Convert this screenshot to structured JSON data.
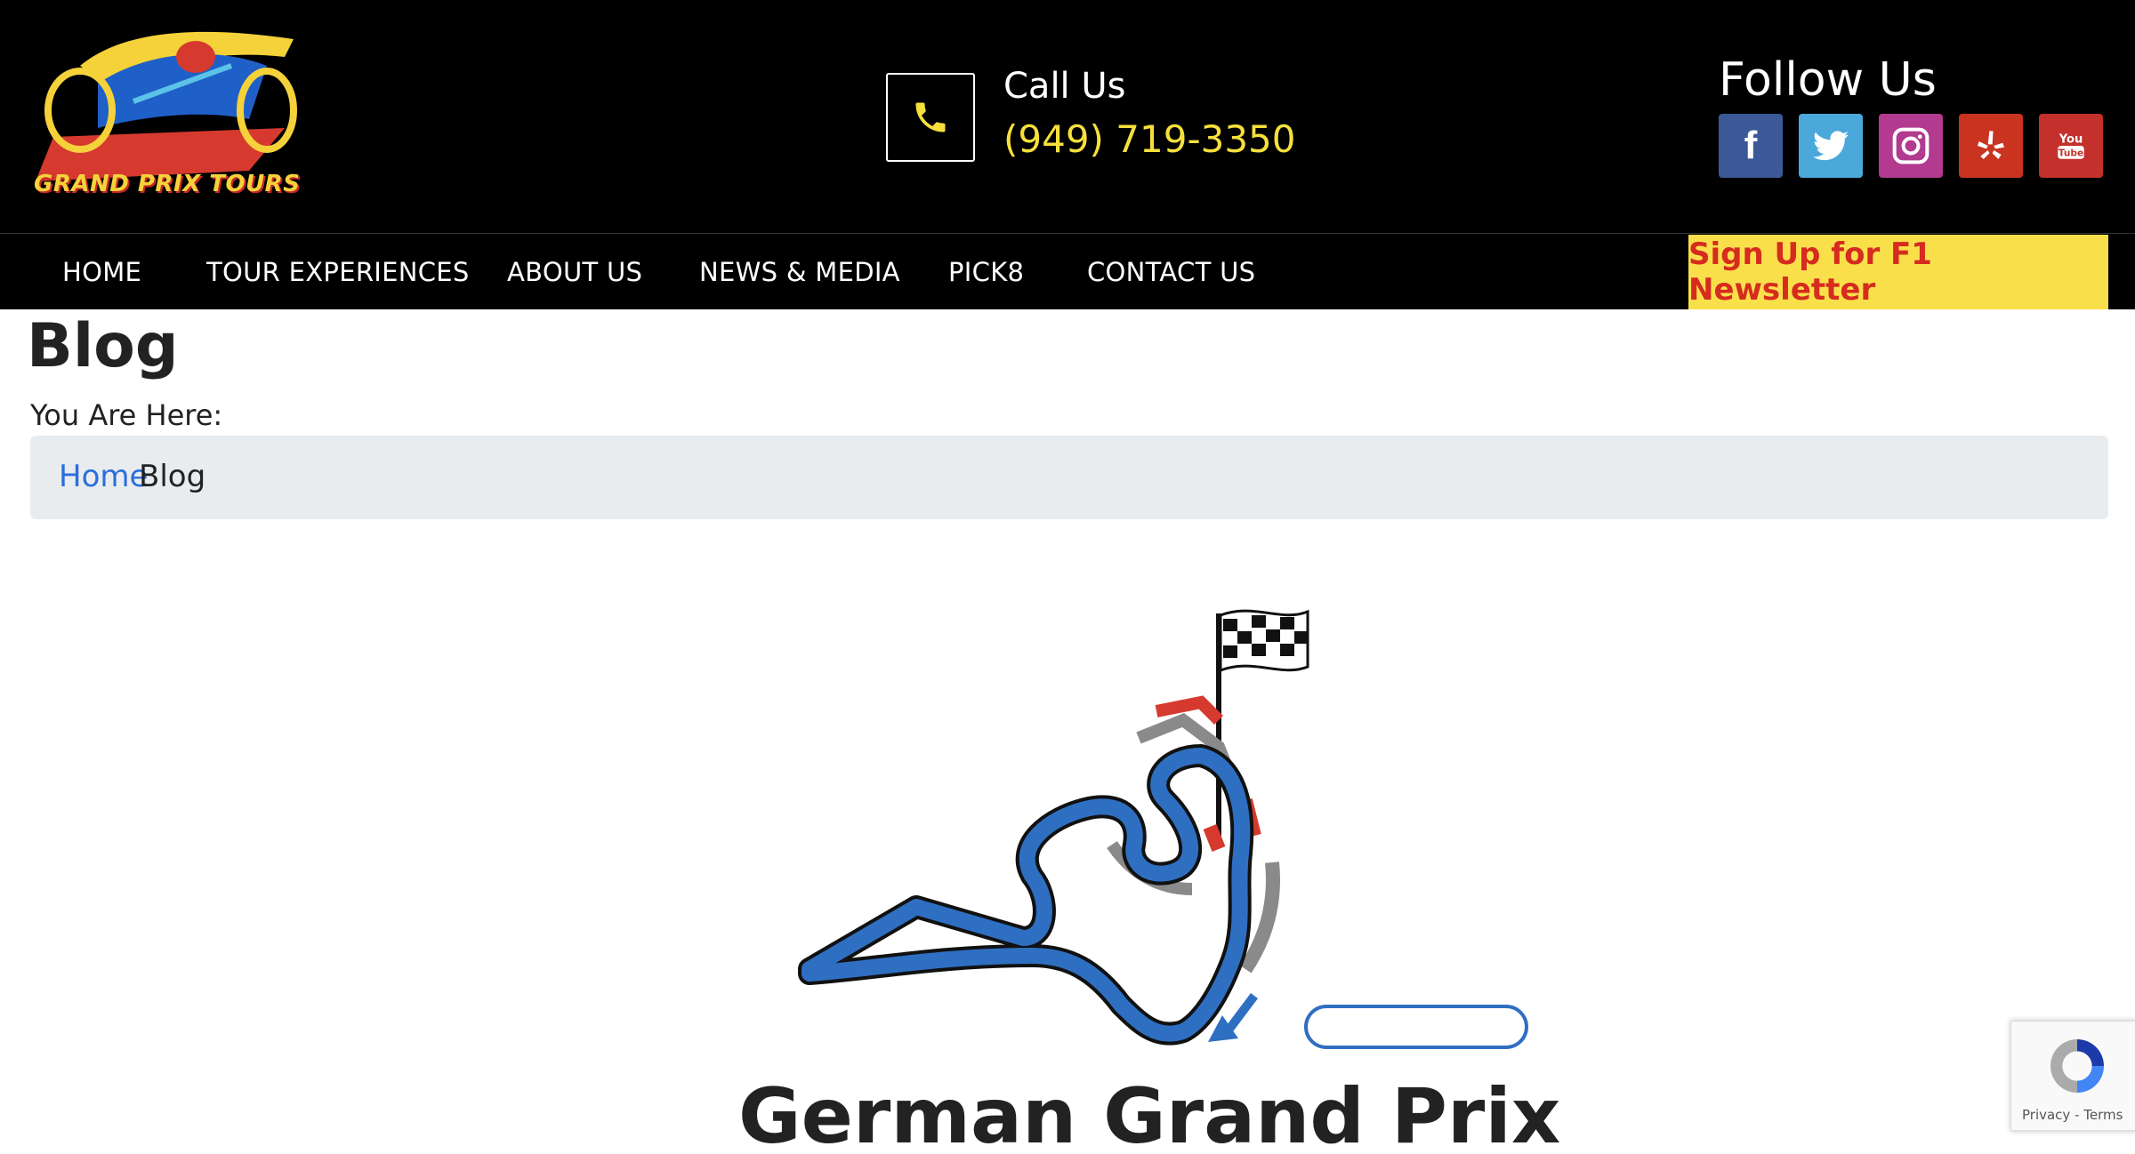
{
  "header": {
    "logo_text": "GRAND PRIX TOURS",
    "call_label": "Call Us",
    "phone": "(949) 719-3350",
    "follow_label": "Follow Us",
    "social": [
      {
        "name": "facebook",
        "icon": "facebook-icon",
        "color": "#3b5998"
      },
      {
        "name": "twitter",
        "icon": "twitter-icon",
        "color": "#4aa8db"
      },
      {
        "name": "instagram",
        "icon": "instagram-icon",
        "color": "#b23a8f"
      },
      {
        "name": "yelp",
        "icon": "yelp-icon",
        "color": "#c9331f"
      },
      {
        "name": "youtube",
        "icon": "youtube-icon",
        "color": "#c4302b"
      }
    ]
  },
  "nav": {
    "items": [
      "HOME",
      "TOUR EXPERIENCES",
      "ABOUT US",
      "NEWS & MEDIA",
      "PICK8",
      "CONTACT US"
    ],
    "newsletter": "Sign Up for F1 Newsletter"
  },
  "page": {
    "title": "Blog",
    "you_are_here": "You Are Here:",
    "breadcrumb": {
      "home": "Home",
      "current": "Blog"
    }
  },
  "article": {
    "title": "German Grand Prix"
  },
  "recaptcha": {
    "links": "Privacy - Terms"
  },
  "colors": {
    "accent_yellow": "#f7e03c",
    "newsletter_bg": "#f9e04b",
    "newsletter_text": "#d62b1f",
    "link_blue": "#2a6fdb",
    "track_blue": "#2f6fc2"
  }
}
